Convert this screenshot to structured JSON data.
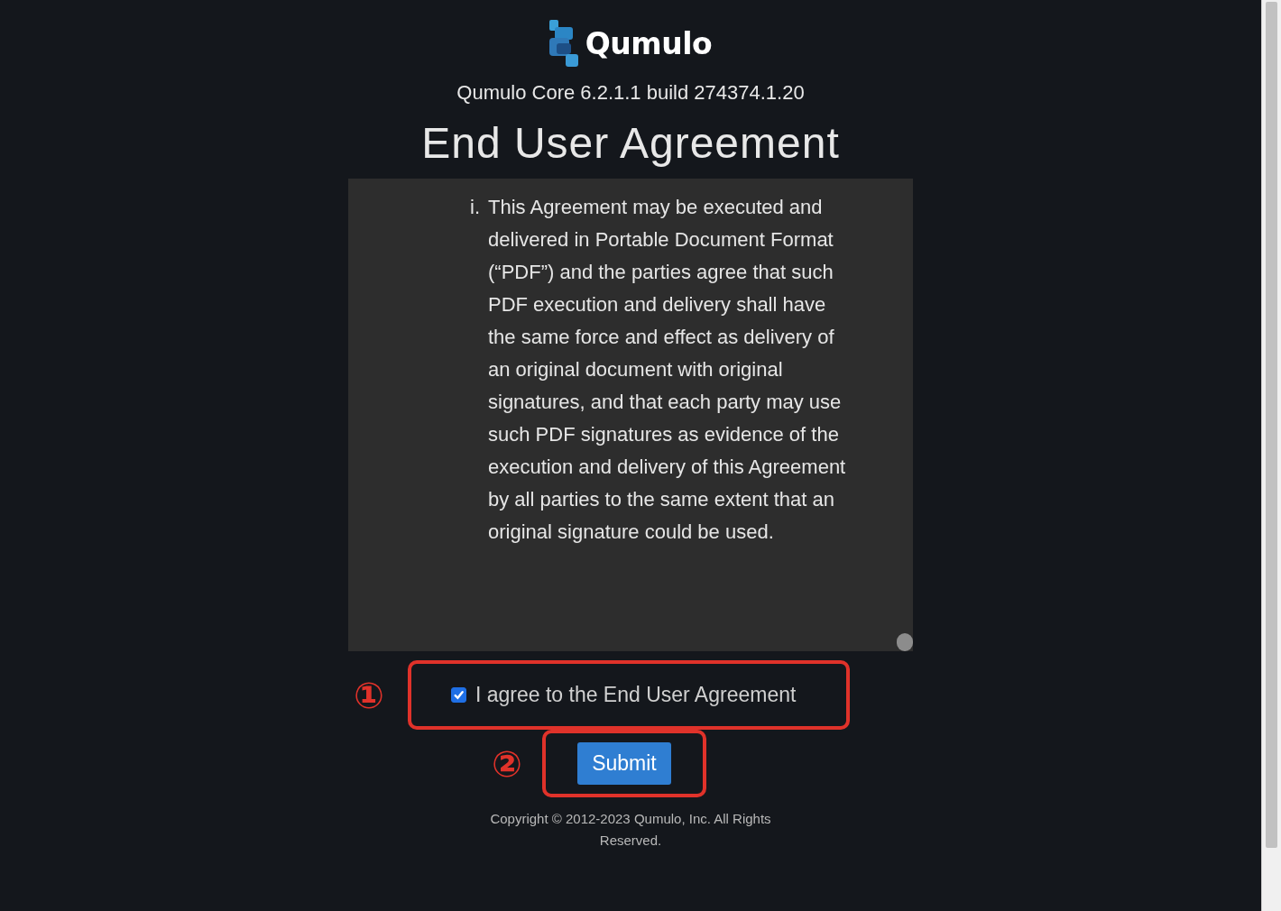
{
  "brand": {
    "name": "Qumulo"
  },
  "version": "Qumulo Core 6.2.1.1 build 274374.1.20",
  "title": "End User Agreement",
  "agreement": {
    "items": [
      {
        "marker": "i.",
        "text": "This Agreement may be executed and delivered in Portable Document Format (“PDF”) and the parties agree that such PDF execution and delivery shall have the same force and effect as delivery of an original document with original signatures, and that each party may use such PDF signatures as evidence of the execution and delivery of this Agreement by all parties to the same extent that an original signature could be used."
      }
    ]
  },
  "consent": {
    "label": "I agree to the End User Agreement",
    "checked": true
  },
  "submit": {
    "label": "Submit"
  },
  "annotations": [
    {
      "number": "①"
    },
    {
      "number": "②"
    }
  ],
  "copyright": "Copyright © 2012-2023 Qumulo, Inc. All Rights Reserved."
}
